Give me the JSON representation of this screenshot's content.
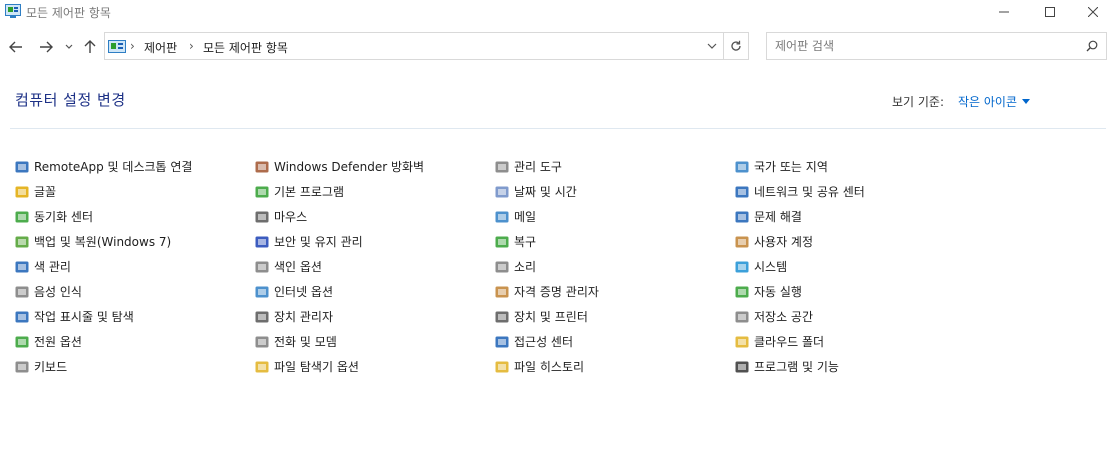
{
  "window": {
    "title": "모든 제어판 항목"
  },
  "nav": {
    "breadcrumbs": [
      "제어판",
      "모든 제어판 항목"
    ],
    "search_placeholder": "제어판 검색"
  },
  "header": {
    "heading": "컴퓨터 설정 변경",
    "view_label": "보기 기준:",
    "view_value": "작은 아이콘"
  },
  "colors": {
    "heading": "#1e3287",
    "link": "#0066cc"
  },
  "columns": [
    [
      {
        "label": "RemoteApp 및 데스크톱 연결",
        "icon": "remoteapp-icon",
        "color": "#1a5fb4"
      },
      {
        "label": "글꼴",
        "icon": "font-icon",
        "color": "#e0a800"
      },
      {
        "label": "동기화 센터",
        "icon": "sync-icon",
        "color": "#2e9e2e"
      },
      {
        "label": "백업 및 복원(Windows 7)",
        "icon": "backup-icon",
        "color": "#4a9e2a"
      },
      {
        "label": "색 관리",
        "icon": "color-management-icon",
        "color": "#1a5fb4"
      },
      {
        "label": "음성 인식",
        "icon": "microphone-icon",
        "color": "#7a7a7a"
      },
      {
        "label": "작업 표시줄 및 탐색",
        "icon": "taskbar-icon",
        "color": "#1a5fb4"
      },
      {
        "label": "전원 옵션",
        "icon": "power-icon",
        "color": "#2e9e2e"
      },
      {
        "label": "키보드",
        "icon": "keyboard-icon",
        "color": "#7a7a7a"
      }
    ],
    [
      {
        "label": "Windows Defender 방화벽",
        "icon": "firewall-icon",
        "color": "#a0522d"
      },
      {
        "label": "기본 프로그램",
        "icon": "default-programs-icon",
        "color": "#2e9e2e"
      },
      {
        "label": "마우스",
        "icon": "mouse-icon",
        "color": "#555555"
      },
      {
        "label": "보안 및 유지 관리",
        "icon": "flag-icon",
        "color": "#1a3fb4"
      },
      {
        "label": "색인 옵션",
        "icon": "indexing-icon",
        "color": "#7a7a7a"
      },
      {
        "label": "인터넷 옵션",
        "icon": "internet-options-icon",
        "color": "#2e7ec4"
      },
      {
        "label": "장치 관리자",
        "icon": "device-manager-icon",
        "color": "#555555"
      },
      {
        "label": "전화 및 모뎀",
        "icon": "phone-modem-icon",
        "color": "#7a7a7a"
      },
      {
        "label": "파일 탐색기 옵션",
        "icon": "folder-options-icon",
        "color": "#e0b020"
      }
    ],
    [
      {
        "label": "관리 도구",
        "icon": "admin-tools-icon",
        "color": "#7a7a7a"
      },
      {
        "label": "날짜 및 시간",
        "icon": "date-time-icon",
        "color": "#6a8ac4"
      },
      {
        "label": "메일",
        "icon": "mail-icon",
        "color": "#2e7ec4"
      },
      {
        "label": "복구",
        "icon": "recovery-icon",
        "color": "#2e9e2e"
      },
      {
        "label": "소리",
        "icon": "speaker-icon",
        "color": "#7a7a7a"
      },
      {
        "label": "자격 증명 관리자",
        "icon": "credential-icon",
        "color": "#c08030"
      },
      {
        "label": "장치 및 프린터",
        "icon": "printer-icon",
        "color": "#555555"
      },
      {
        "label": "접근성 센터",
        "icon": "accessibility-icon",
        "color": "#1a5fb4"
      },
      {
        "label": "파일 히스토리",
        "icon": "file-history-icon",
        "color": "#e0b020"
      }
    ],
    [
      {
        "label": "국가 또는 지역",
        "icon": "globe-icon",
        "color": "#2e7ec4"
      },
      {
        "label": "네트워크 및 공유 센터",
        "icon": "network-icon",
        "color": "#1a5fb4"
      },
      {
        "label": "문제 해결",
        "icon": "troubleshoot-icon",
        "color": "#1a5fb4"
      },
      {
        "label": "사용자 계정",
        "icon": "user-accounts-icon",
        "color": "#c08030"
      },
      {
        "label": "시스템",
        "icon": "system-icon",
        "color": "#1a8fd4"
      },
      {
        "label": "자동 실행",
        "icon": "autoplay-icon",
        "color": "#2e9e2e"
      },
      {
        "label": "저장소 공간",
        "icon": "storage-icon",
        "color": "#7a7a7a"
      },
      {
        "label": "클라우드 폴더",
        "icon": "cloud-folder-icon",
        "color": "#e0b020"
      },
      {
        "label": "프로그램 및 기능",
        "icon": "programs-features-icon",
        "color": "#333333"
      }
    ]
  ]
}
